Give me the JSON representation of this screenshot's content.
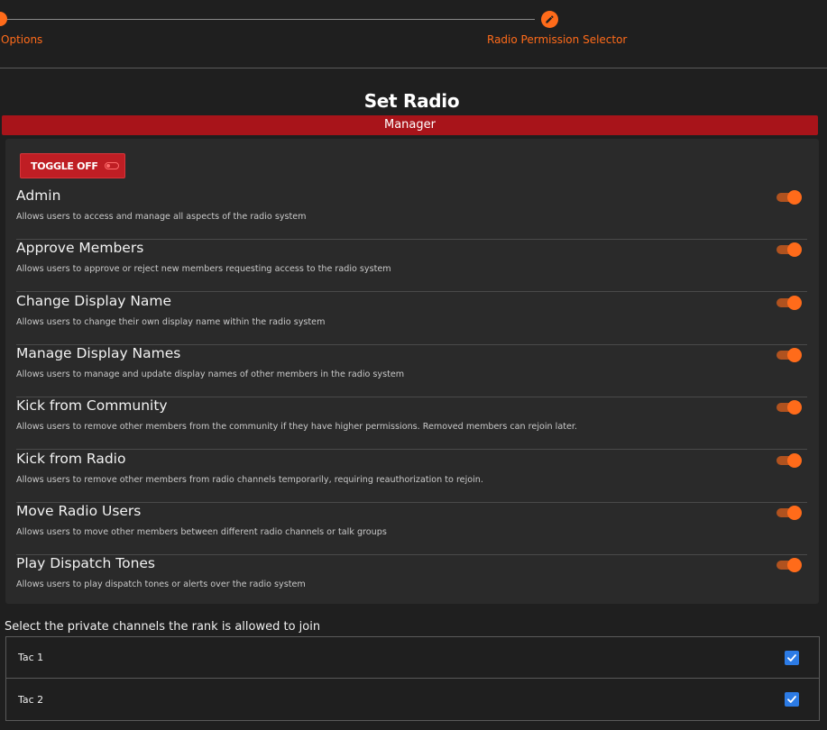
{
  "stepper": {
    "steps": [
      {
        "label": "Options"
      },
      {
        "label": "Radio Permission Selector"
      }
    ]
  },
  "title": "Set Radio",
  "rank": "Manager",
  "toggle_all_label": "TOGGLE OFF",
  "permissions": [
    {
      "title": "Admin",
      "description": "Allows users to access and manage all aspects of the radio system",
      "enabled": true
    },
    {
      "title": "Approve Members",
      "description": "Allows users to approve or reject new members requesting access to the radio system",
      "enabled": true
    },
    {
      "title": "Change Display Name",
      "description": "Allows users to change their own display name within the radio system",
      "enabled": true
    },
    {
      "title": "Manage Display Names",
      "description": "Allows users to manage and update display names of other members in the radio system",
      "enabled": true
    },
    {
      "title": "Kick from Community",
      "description": "Allows users to remove other members from the community if they have higher permissions. Removed members can rejoin later.",
      "enabled": true
    },
    {
      "title": "Kick from Radio",
      "description": "Allows users to remove other members from radio channels temporarily, requiring reauthorization to rejoin.",
      "enabled": true
    },
    {
      "title": "Move Radio Users",
      "description": "Allows users to move other members between different radio channels or talk groups",
      "enabled": true
    },
    {
      "title": "Play Dispatch Tones",
      "description": "Allows users to play dispatch tones or alerts over the radio system",
      "enabled": true
    }
  ],
  "channels": {
    "label": "Select the private channels the rank is allowed to join",
    "items": [
      {
        "name": "Tac 1",
        "checked": true
      },
      {
        "name": "Tac 2",
        "checked": true
      }
    ]
  },
  "colors": {
    "accent": "#ff6b1a",
    "rank_bar": "#a8141a",
    "toggle_button": "#bf1e24",
    "checkbox": "#2c7be5"
  },
  "icons": {
    "current_step": "pencil-icon",
    "checkbox": "checkmark-icon"
  }
}
